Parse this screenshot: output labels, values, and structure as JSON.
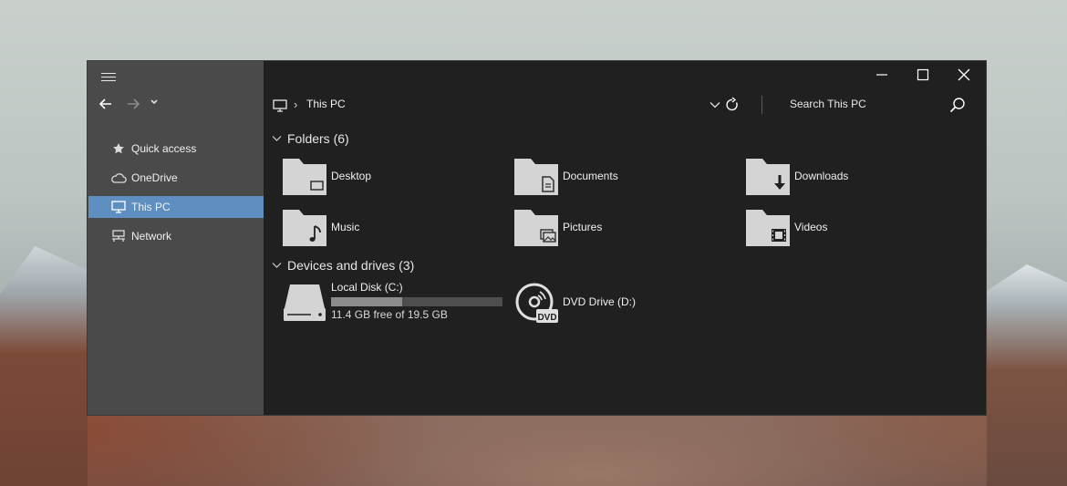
{
  "window": {
    "title": "This PC"
  },
  "nav": {
    "items": [
      {
        "label": "Quick access",
        "icon": "star-icon"
      },
      {
        "label": "OneDrive",
        "icon": "cloud-icon"
      },
      {
        "label": "This PC",
        "icon": "computer-icon",
        "selected": true
      },
      {
        "label": "Network",
        "icon": "network-icon"
      }
    ]
  },
  "address": {
    "path": "This PC"
  },
  "search": {
    "placeholder": "Search This PC"
  },
  "sections": {
    "folders": {
      "title": "Folders (6)",
      "items": [
        {
          "label": "Desktop",
          "icon": "desktop-folder-icon"
        },
        {
          "label": "Documents",
          "icon": "documents-folder-icon"
        },
        {
          "label": "Downloads",
          "icon": "downloads-folder-icon"
        },
        {
          "label": "Music",
          "icon": "music-folder-icon"
        },
        {
          "label": "Pictures",
          "icon": "pictures-folder-icon"
        },
        {
          "label": "Videos",
          "icon": "videos-folder-icon"
        }
      ]
    },
    "drives": {
      "title": "Devices and drives (3)",
      "items": [
        {
          "label": "Local Disk (C:)",
          "free": "11.4 GB free of 19.5 GB",
          "used_fraction": 0.415,
          "icon": "hard-disk-icon"
        },
        {
          "label": "DVD Drive (D:)",
          "icon": "dvd-drive-icon",
          "badge": "DVD"
        }
      ]
    }
  },
  "colors": {
    "accent": "#5f8fc0",
    "nav_bg": "#4a4a4a",
    "main_bg": "#202020",
    "folder": "#d4d4d4"
  }
}
